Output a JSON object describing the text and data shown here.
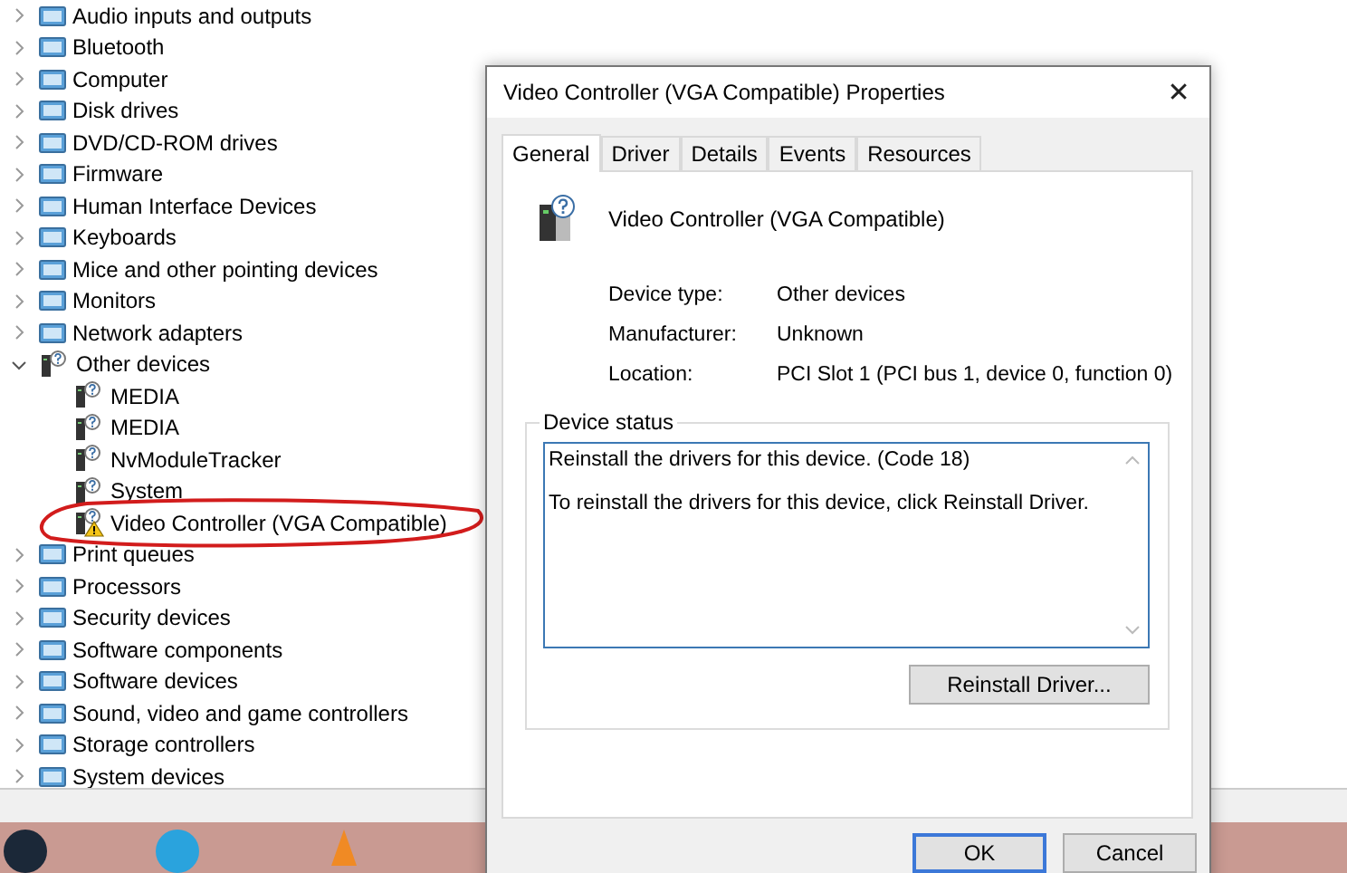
{
  "device_tree": [
    {
      "label": "Audio inputs and outputs",
      "expanded": false
    },
    {
      "label": "Bluetooth",
      "expanded": false
    },
    {
      "label": "Computer",
      "expanded": false
    },
    {
      "label": "Disk drives",
      "expanded": false
    },
    {
      "label": "DVD/CD-ROM drives",
      "expanded": false
    },
    {
      "label": "Firmware",
      "expanded": false
    },
    {
      "label": "Human Interface Devices",
      "expanded": false
    },
    {
      "label": "Keyboards",
      "expanded": false
    },
    {
      "label": "Mice and other pointing devices",
      "expanded": false
    },
    {
      "label": "Monitors",
      "expanded": false
    },
    {
      "label": "Network adapters",
      "expanded": false
    },
    {
      "label": "Other devices",
      "expanded": true,
      "children": [
        {
          "label": "MEDIA",
          "warning": false,
          "circled": false
        },
        {
          "label": "MEDIA",
          "warning": false,
          "circled": false
        },
        {
          "label": "NvModuleTracker",
          "warning": false,
          "circled": false
        },
        {
          "label": "System",
          "warning": false,
          "circled": false
        },
        {
          "label": "Video Controller (VGA Compatible)",
          "warning": true,
          "circled": true
        }
      ]
    },
    {
      "label": "Print queues",
      "expanded": false
    },
    {
      "label": "Processors",
      "expanded": false
    },
    {
      "label": "Security devices",
      "expanded": false
    },
    {
      "label": "Software components",
      "expanded": false
    },
    {
      "label": "Software devices",
      "expanded": false
    },
    {
      "label": "Sound, video and game controllers",
      "expanded": false
    },
    {
      "label": "Storage controllers",
      "expanded": false
    },
    {
      "label": "System devices",
      "expanded": false
    }
  ],
  "dialog": {
    "title": "Video Controller (VGA Compatible) Properties",
    "close": "✕",
    "tabs": [
      {
        "label": "General",
        "selected": true
      },
      {
        "label": "Driver",
        "selected": false
      },
      {
        "label": "Details",
        "selected": false
      },
      {
        "label": "Events",
        "selected": false
      },
      {
        "label": "Resources",
        "selected": false
      }
    ],
    "device_name": "Video Controller (VGA Compatible)",
    "properties": [
      {
        "label": "Device type:",
        "value": "Other devices"
      },
      {
        "label": "Manufacturer:",
        "value": "Unknown"
      },
      {
        "label": "Location:",
        "value": "PCI Slot 1 (PCI bus 1, device 0, function 0)"
      }
    ],
    "status_group": "Device status",
    "status_lines": [
      "Reinstall the drivers for this device. (Code 18)",
      "To reinstall the drivers for this device, click Reinstall Driver."
    ],
    "reinstall_button": "Reinstall Driver...",
    "buttons": [
      {
        "label": "OK",
        "default": true
      },
      {
        "label": "Cancel",
        "default": false
      }
    ]
  }
}
